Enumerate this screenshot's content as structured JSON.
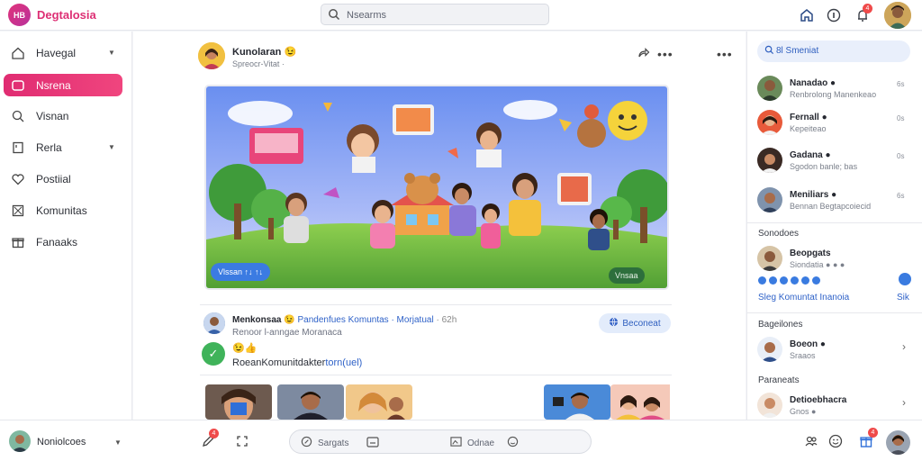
{
  "app": {
    "logo_text": "HB",
    "brand": "Degtalosia"
  },
  "search": {
    "text": "Nsearms"
  },
  "topbar": {
    "notif_count": "4"
  },
  "sidebar": {
    "items": [
      {
        "label": "Havegal",
        "icon": "home-icon",
        "has_chevron": true
      },
      {
        "label": "Nsrena",
        "icon": "chat-bubble-icon",
        "active": true
      },
      {
        "label": "Visnan",
        "icon": "search-icon"
      },
      {
        "label": "Rerla",
        "icon": "bookmark-icon",
        "has_chevron": true
      },
      {
        "label": "Postiial",
        "icon": "heart-icon"
      },
      {
        "label": "Komunitas",
        "icon": "image-icon"
      },
      {
        "label": "Fanaaks",
        "icon": "gift-icon"
      }
    ],
    "user": {
      "name": "Noniolcoes"
    }
  },
  "post": {
    "author": "Kunolaran 😉",
    "subtitle": "Spreocr-Vitat ·",
    "banner_chip_left": "Vlssan ↑↓ ↑↓",
    "banner_chip_right": "Vnsaa"
  },
  "comment": {
    "name": "Menkonsaa 😉",
    "group": "Pandenfues Komuntas · Morjatual",
    "time": "· 62h",
    "subtitle": "Renoor l-anngae Moranaca",
    "emoji": "😉👍",
    "text_main": "RoeanKomunitdakter",
    "text_link": "torn(uel)",
    "follow_label": "Beconeat"
  },
  "right": {
    "search_label": "8l Smeniat",
    "contacts": [
      {
        "name": "Nanadao ●",
        "sub": "Renbrolong Manenkeao",
        "time": "6s"
      },
      {
        "name": "Fernall ●",
        "sub": "Kepeiteao",
        "time": "0s"
      },
      {
        "name": "Gadana ●",
        "sub": "Sgodon banle; bas",
        "time": "0s"
      },
      {
        "name": "Meniliars ●",
        "sub": "Bennan Begtapcoiecid",
        "time": "6s"
      }
    ],
    "section1": "Sonodoes",
    "group": {
      "name": "Beopgats",
      "sub": "Siondatia ● ● ●",
      "time": ""
    },
    "group_link": "Sleg Komuntat Inanoia",
    "group_link2": "Sik",
    "section2": "Bageilones",
    "g2": {
      "name": "Boeon ●",
      "sub": "Sraaos"
    },
    "section3": "Paraneats",
    "g3": {
      "name": "Detioebhacra",
      "sub": "Gnos ●"
    }
  },
  "bottom": {
    "compose_left": "Sargats",
    "compose_right": "Odnae",
    "draft_count": "4",
    "gift_count": "4"
  }
}
